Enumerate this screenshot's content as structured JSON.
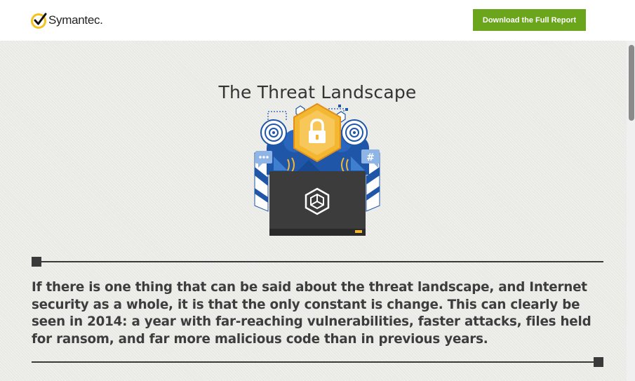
{
  "header": {
    "brand": "Symantec.",
    "logo_icon": "checkmark-circle-icon",
    "cta_label": "Download the Full Report"
  },
  "main": {
    "title": "The Threat Landscape",
    "illustration_icon": "security-lock-illustration",
    "lead": "If there is one thing that can be said about the threat landscape, and Internet security as a whole, it is that the only constant is change. This can clearly be seen in 2014: a year with far-reaching vulnerabilities, faster attacks, files held for ransom, and far more malicious code than in previous years."
  },
  "colors": {
    "accent_green": "#6aa51c",
    "logo_yellow": "#f6c21b",
    "lock_yellow": "#f4b731",
    "illustration_blue": "#1f56a8",
    "text_dark": "#3d3d3d"
  }
}
